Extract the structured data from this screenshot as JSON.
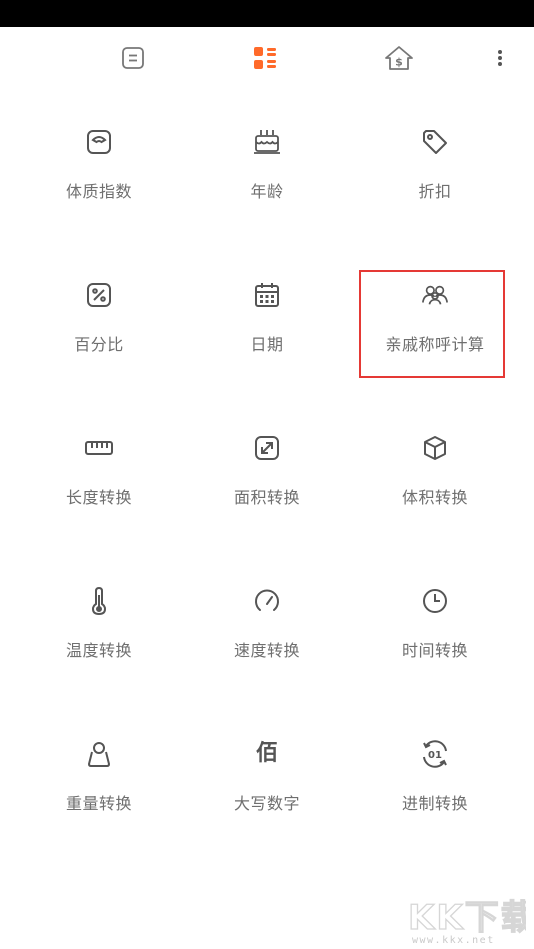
{
  "nav": {
    "tabs": [
      {
        "name": "calculator",
        "icon": "equals-square-icon",
        "color": "#777777",
        "active": false
      },
      {
        "name": "tools",
        "icon": "grid-list-icon",
        "color": "#ff6a2a",
        "active": true
      },
      {
        "name": "currency",
        "icon": "house-dollar-icon",
        "color": "#777777",
        "active": false
      }
    ],
    "more_icon": "more-vertical-icon"
  },
  "tools": [
    {
      "id": "bmi",
      "label": "体质指数",
      "icon": "scale-icon"
    },
    {
      "id": "age",
      "label": "年龄",
      "icon": "cake-icon"
    },
    {
      "id": "discount",
      "label": "折扣",
      "icon": "tag-icon"
    },
    {
      "id": "percent",
      "label": "百分比",
      "icon": "percent-icon"
    },
    {
      "id": "date",
      "label": "日期",
      "icon": "calendar-icon"
    },
    {
      "id": "relatives",
      "label": "亲戚称呼计算",
      "icon": "users-icon"
    },
    {
      "id": "length",
      "label": "长度转换",
      "icon": "ruler-icon"
    },
    {
      "id": "area",
      "label": "面积转换",
      "icon": "expand-icon"
    },
    {
      "id": "volume",
      "label": "体积转换",
      "icon": "cube-icon"
    },
    {
      "id": "temperature",
      "label": "温度转换",
      "icon": "thermometer-icon"
    },
    {
      "id": "speed",
      "label": "速度转换",
      "icon": "speedometer-icon"
    },
    {
      "id": "time",
      "label": "时间转换",
      "icon": "clock-icon"
    },
    {
      "id": "weight",
      "label": "重量转换",
      "icon": "weight-icon"
    },
    {
      "id": "uppercase",
      "label": "大写数字",
      "icon": "bai-character-icon",
      "glyph": "佰"
    },
    {
      "id": "radix",
      "label": "进制转换",
      "icon": "binary-icon",
      "glyph": "01"
    }
  ],
  "highlighted_tool": "relatives",
  "colors": {
    "accent": "#ff6a2a",
    "label": "#6f6f6f",
    "icon": "#555555",
    "highlight": "#e53935"
  },
  "watermark": {
    "main": "KK下载",
    "url": "www.kkx.net"
  }
}
